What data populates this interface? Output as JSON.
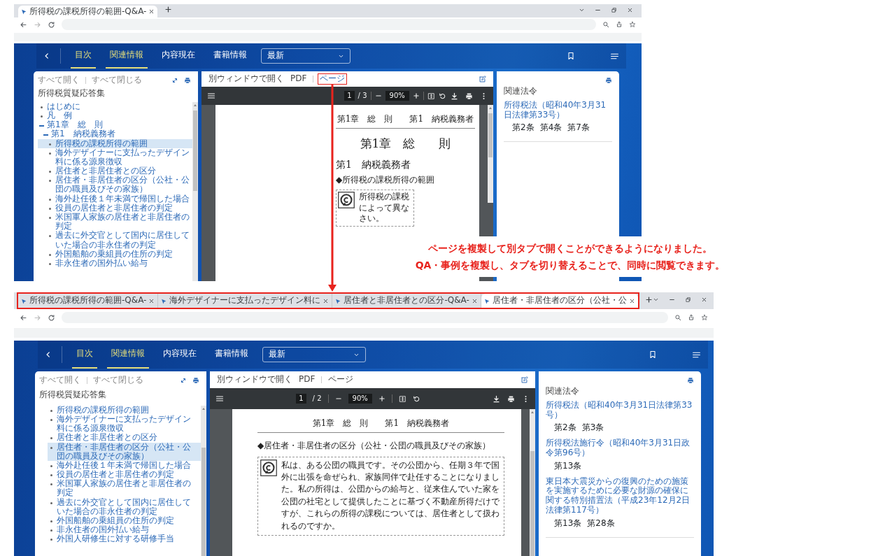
{
  "screenshots": [
    {
      "tabs": [
        {
          "title": "所得税の課税所得の範囲-Q&A-",
          "selected": true
        }
      ],
      "tabs_highlighted": false,
      "nav": {
        "items": [
          {
            "label": "目次",
            "selected": true
          },
          {
            "label": "関連情報",
            "selected": true
          },
          {
            "label": "内容現在",
            "selected": false
          },
          {
            "label": "書籍情報",
            "selected": false
          }
        ],
        "version": "最新"
      },
      "toc": {
        "expand_all": "すべて開く",
        "collapse_all": "すべて閉じる",
        "title": "所得税質疑応答集",
        "items": [
          {
            "label": "はじめに",
            "selected": false
          },
          {
            "label": "凡　例",
            "selected": false
          },
          {
            "label": "第1章　総　則",
            "selected": false,
            "expanded": true,
            "children": [
              {
                "label": "第1　納税義務者",
                "selected": false,
                "expanded": true,
                "children": [
                  {
                    "label": "所得税の課税所得の範囲",
                    "selected": true
                  },
                  {
                    "label": "海外デザイナーに支払ったデザイン料に係る源泉徴収",
                    "selected": false
                  },
                  {
                    "label": "居住者と非居住者との区分",
                    "selected": false
                  },
                  {
                    "label": "居住者・非居住者の区分（公社・公団の職員及びその家族）",
                    "selected": false
                  },
                  {
                    "label": "海外赴任後１年未満で帰国した場合",
                    "selected": false
                  },
                  {
                    "label": "役員の居住者と非居住者の判定",
                    "selected": false
                  },
                  {
                    "label": "米国軍人家族の居住者と非居住者の判定",
                    "selected": false
                  },
                  {
                    "label": "過去に外交官として国内に居住していた場合の非永住者の判定",
                    "selected": false
                  },
                  {
                    "label": "外国船舶の乗組員の住所の判定",
                    "selected": false
                  },
                  {
                    "label": "非永住者の国外払い給与",
                    "selected": false
                  }
                ]
              }
            ]
          }
        ]
      },
      "viewer": {
        "open_window": "別ウィンドウで開く",
        "links": [
          {
            "label": "PDF",
            "highlighted": false
          },
          {
            "label": "ページ",
            "highlighted": true
          }
        ],
        "page": "1",
        "page_count": "/ 3",
        "zoom": "90%",
        "document": {
          "running_head": "第1章　総　則　　第1　納税義務者",
          "chapter": "第1章　総　　則",
          "section": "第1　納税義務者",
          "question_title": "◆所得税の課税所得の範囲",
          "question_lines": [
            "所得税の課税",
            "によって異な",
            "さい。"
          ]
        }
      },
      "related": {
        "title": "関連法令",
        "laws": [
          {
            "name": "所得税法（昭和40年3月31日法律第33号）",
            "articles": [
              "第2条",
              "第4条",
              "第7条"
            ]
          }
        ]
      }
    },
    {
      "tabs": [
        {
          "title": "所得税の課税所得の範囲-Q&A-",
          "selected": false
        },
        {
          "title": "海外デザイナーに支払ったデザイン料に",
          "selected": false
        },
        {
          "title": "居住者と非居住者との区分-Q&A-",
          "selected": false
        },
        {
          "title": "居住者・非居住者の区分（公社・公",
          "selected": true
        }
      ],
      "tabs_highlighted": true,
      "nav": {
        "items": [
          {
            "label": "目次",
            "selected": true
          },
          {
            "label": "関連情報",
            "selected": true
          },
          {
            "label": "内容現在",
            "selected": false
          },
          {
            "label": "書籍情報",
            "selected": false
          }
        ],
        "version": "最新"
      },
      "toc": {
        "expand_all": "すべて開く",
        "collapse_all": "すべて閉じる",
        "title": "所得税質疑応答集",
        "items": [
          {
            "label": "所得税の課税所得の範囲",
            "selected": false
          },
          {
            "label": "海外デザイナーに支払ったデザイン料に係る源泉徴収",
            "selected": false
          },
          {
            "label": "居住者と非居住者との区分",
            "selected": false
          },
          {
            "label": "居住者・非居住者の区分（公社・公団の職員及びその家族）",
            "selected": true
          },
          {
            "label": "海外赴任後１年未満で帰国した場合",
            "selected": false
          },
          {
            "label": "役員の居住者と非居住者の判定",
            "selected": false
          },
          {
            "label": "米国軍人家族の居住者と非居住者の判定",
            "selected": false
          },
          {
            "label": "過去に外交官として国内に居住していた場合の非永住者の判定",
            "selected": false
          },
          {
            "label": "外国船舶の乗組員の住所の判定",
            "selected": false
          },
          {
            "label": "非永住者の国外払い給与",
            "selected": false
          },
          {
            "label": "外国人研修生に対する研修手当",
            "selected": false
          }
        ]
      },
      "viewer": {
        "open_window": "別ウィンドウで開く",
        "links": [
          {
            "label": "PDF",
            "highlighted": false
          },
          {
            "label": "ページ",
            "highlighted": false
          }
        ],
        "page": "1",
        "page_count": "/ 2",
        "zoom": "90%",
        "document": {
          "running_head": "第1章　総　則　　第1　納税義務者",
          "question_title": "◆居住者・非居住者の区分（公社・公団の職員及びその家族）",
          "question_text": "私は、ある公団の職員です。その公団から、任期３年で国外に出張を命ぜられ、家族同伴で赴任することになりました。私の所得は、公団からの給与と、従来住んでいた家を公団の社宅として提供したことに基づく不動産所得だけですが、これらの所得の課税については、居住者として扱われるのですか。"
        }
      },
      "related": {
        "title": "関連法令",
        "laws": [
          {
            "name": "所得税法（昭和40年3月31日法律第33号）",
            "articles": [
              "第2条",
              "第3条"
            ]
          },
          {
            "name": "所得税法施行令（昭和40年3月31日政令第96号）",
            "articles": [
              "第13条"
            ]
          },
          {
            "name": "東日本大震災からの復興のための施策を実施するために必要な財源の確保に関する特別措置法（平成23年12月2日法律第117号）",
            "articles": [
              "第13条",
              "第28条"
            ]
          }
        ]
      }
    }
  ],
  "annotation": {
    "lines": [
      "ページを複製して別タブで開くことができるようになりました。",
      "QA・事例を複製し、タブを切り替えることで、同時に閲覧できます。"
    ]
  }
}
